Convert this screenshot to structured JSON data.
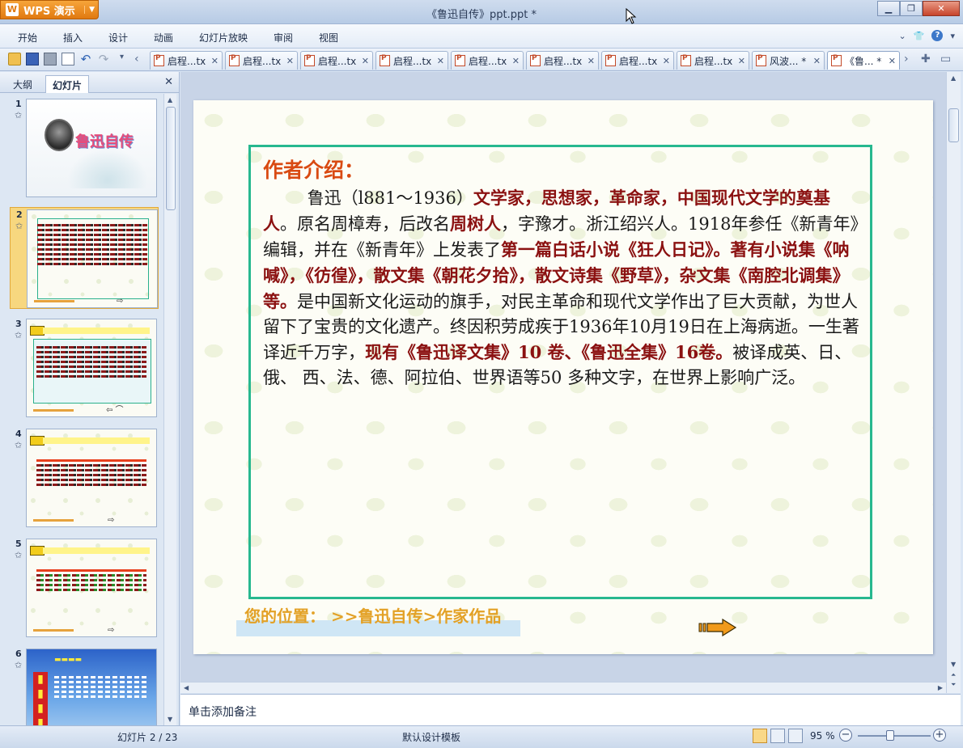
{
  "app": {
    "name": "WPS 演示",
    "window_title": "《鲁迅自传》ppt.ppt *"
  },
  "menu": [
    "开始",
    "插入",
    "设计",
    "动画",
    "幻灯片放映",
    "审阅",
    "视图"
  ],
  "tabs": [
    {
      "label": "启程...tx",
      "active": false
    },
    {
      "label": "启程...tx",
      "active": false
    },
    {
      "label": "启程...tx",
      "active": false
    },
    {
      "label": "启程...tx",
      "active": false
    },
    {
      "label": "启程...tx",
      "active": false
    },
    {
      "label": "启程...tx",
      "active": false
    },
    {
      "label": "启程...tx",
      "active": false
    },
    {
      "label": "启程...tx",
      "active": false
    },
    {
      "label": "风波... *",
      "active": false
    },
    {
      "label": "《鲁... *",
      "active": true
    }
  ],
  "left_panel": {
    "tab_outline": "大纲",
    "tab_slides": "幻灯片",
    "slide_numbers": [
      "1",
      "2",
      "3",
      "4",
      "5",
      "6"
    ],
    "selected_slide": 2,
    "thumb1_title": "鲁迅自传"
  },
  "slide": {
    "heading": "作者介绍：",
    "body_segments": [
      {
        "text": "鲁迅（l881～1936）",
        "hl": false
      },
      {
        "text": "文学家，思想家，革命家，中国现代文学的奠基人",
        "hl": true
      },
      {
        "text": "。原名周樟寿，后改名",
        "hl": false
      },
      {
        "text": "周树人",
        "hl": true
      },
      {
        "text": "，字豫才。浙江绍兴人。1918年参任《新青年》编辑，并在《新青年》上发表了",
        "hl": false
      },
      {
        "text": "第一篇白话小说《狂人日记》。著有小说集《呐喊》，《彷徨》，散文集《朝花夕拾》，散文诗集《野草》，杂文集《南腔北调集》等。",
        "hl": true
      },
      {
        "text": "是中国新文化运动的旗手，对民主革命和现代文学作出了巨大贡献，为世人留下了宝贵的文化遗产。终因积劳成疾于1936年10月19日在上海病逝。一生著译近千万字，",
        "hl": false
      },
      {
        "text": "现有《鲁迅译文集》10 卷、《鲁迅全集》16卷。",
        "hl": true
      },
      {
        "text": "被译成英、日、俄、 西、法、德、阿拉伯、世界语等50 多种文字，在世界上影响广泛。",
        "hl": false
      }
    ],
    "position_text": "您的位置：  >>鲁迅自传>作家作品"
  },
  "notes_placeholder": "单击添加备注",
  "status": {
    "slide_info": "幻灯片 2 / 23",
    "template": "默认设计模板",
    "zoom": "95 %"
  },
  "colors": {
    "heading": "#d94a12",
    "highlight": "#8b1111",
    "frame": "#27b88f",
    "position_text": "#e3a126"
  }
}
